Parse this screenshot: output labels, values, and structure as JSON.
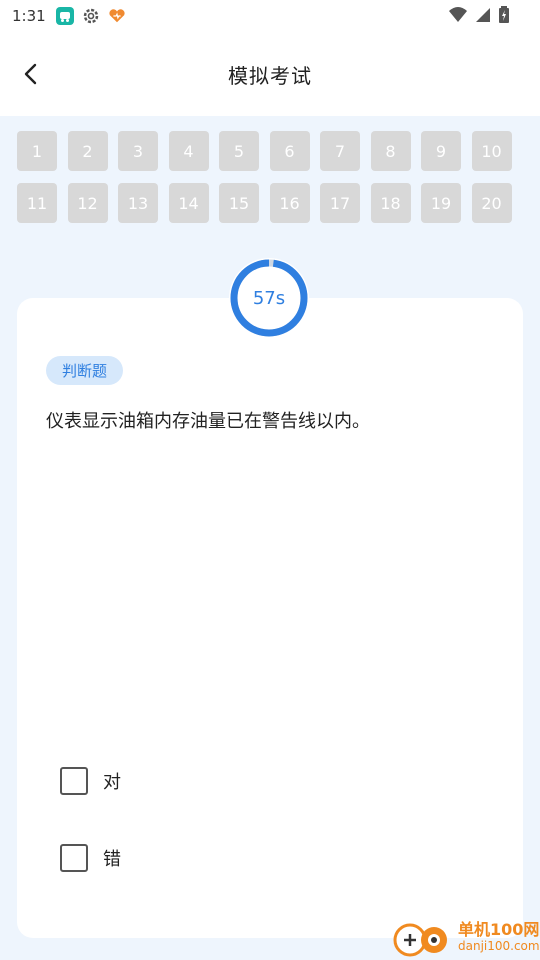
{
  "status_bar": {
    "time": "1:31"
  },
  "header": {
    "title": "模拟考试"
  },
  "question_nav": {
    "numbers": [
      "1",
      "2",
      "3",
      "4",
      "5",
      "6",
      "7",
      "8",
      "9",
      "10",
      "11",
      "12",
      "13",
      "14",
      "15",
      "16",
      "17",
      "18",
      "19",
      "20"
    ]
  },
  "timer": {
    "label": "57s",
    "remaining_fraction": 0.98
  },
  "question": {
    "type": "判断题",
    "text": "仪表显示油箱内存油量已在警告线以内。",
    "options": [
      {
        "label": "对"
      },
      {
        "label": "错"
      }
    ]
  },
  "watermark": {
    "main": "单机100网",
    "sub": "danji100.com"
  },
  "colors": {
    "accent": "#2f7fe0",
    "background": "#eef5fd",
    "nav_inactive": "#d8d8d8"
  }
}
